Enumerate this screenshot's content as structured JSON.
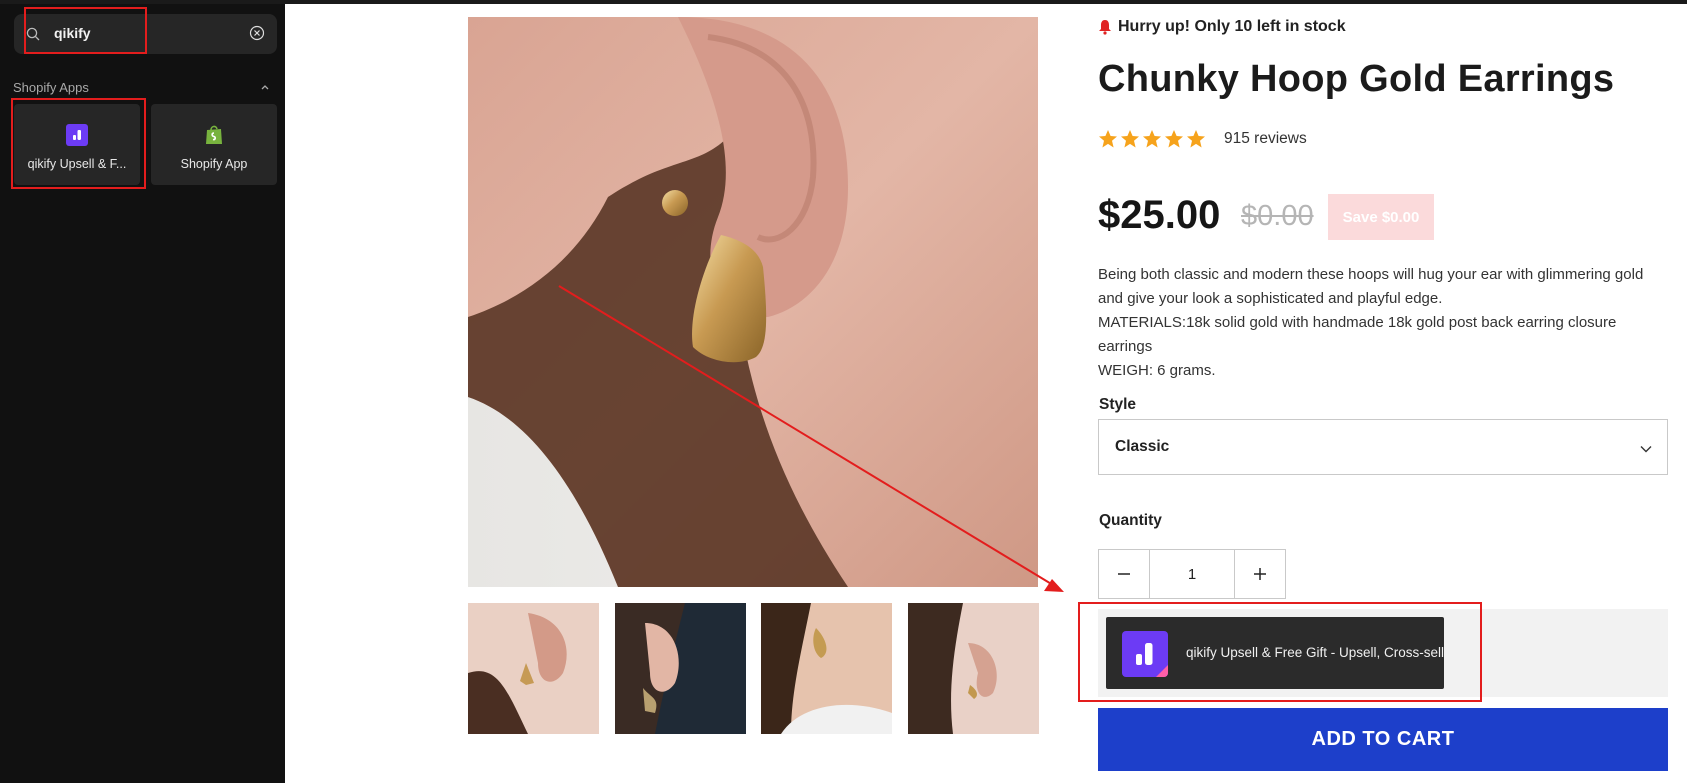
{
  "sidebar": {
    "search": {
      "value": "qikify"
    },
    "section_title": "Shopify Apps",
    "apps": [
      {
        "label": "qikify Upsell & F...",
        "icon": "qikify-icon"
      },
      {
        "label": "Shopify App",
        "icon": "shopify-bag-icon"
      }
    ]
  },
  "product": {
    "stock_notice": "Hurry up! Only 10 left in stock",
    "title": "Chunky Hoop Gold Earrings",
    "rating": 5,
    "rating_max": 5,
    "reviews": "915 reviews",
    "price": "$25.00",
    "compare_price": "$0.00",
    "save_label": "Save $0.00",
    "description": [
      "Being both classic and modern these hoops will hug your ear with glimmering gold and give your look a sophisticated and playful edge.",
      "MATERIALS:18k solid gold with handmade 18k gold post back earring closure earrings",
      "WEIGH: 6 grams."
    ],
    "style_label": "Style",
    "style_value": "Classic",
    "quantity_label": "Quantity",
    "quantity_value": "1",
    "app_block_label": "qikify Upsell & Free Gift - Upsell, Cross-sell",
    "add_to_cart": "ADD TO CART"
  },
  "colors": {
    "accent_blue": "#1d3fca",
    "star": "#f6a31c",
    "highlight": "#e31d1d",
    "save_badge": "#fbdadb",
    "qikify_purple": "#6c3bf5"
  }
}
